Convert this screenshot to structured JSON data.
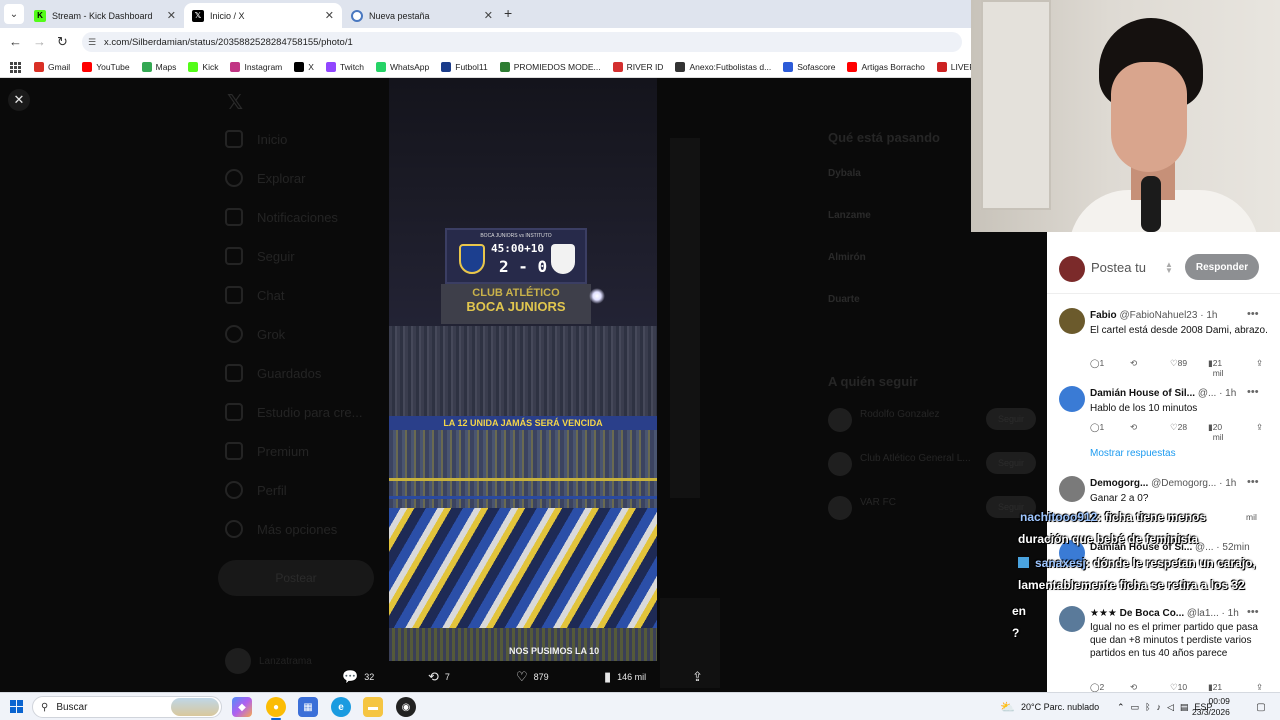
{
  "browser": {
    "tabs": [
      {
        "label": "Stream - Kick Dashboard",
        "icon": "kick-icon",
        "active": false
      },
      {
        "label": "Inicio / X",
        "icon": "x-logo-icon",
        "active": true
      },
      {
        "label": "Nueva pestaña",
        "icon": "chrome-icon",
        "active": false
      }
    ],
    "url": "x.com/Silberdamian/status/2035882528284758155/photo/1",
    "bookmarks": [
      {
        "label": "Gmail",
        "color": "#d93025"
      },
      {
        "label": "YouTube",
        "color": "#ff0000"
      },
      {
        "label": "Maps",
        "color": "#34a853"
      },
      {
        "label": "Kick",
        "color": "#53fc18"
      },
      {
        "label": "Instagram",
        "color": "#c13584"
      },
      {
        "label": "X",
        "color": "#000000"
      },
      {
        "label": "Twitch",
        "color": "#9146ff"
      },
      {
        "label": "WhatsApp",
        "color": "#25d366"
      },
      {
        "label": "Futbol11",
        "color": "#1a3b8a"
      },
      {
        "label": "PROMIEDOS MODE...",
        "color": "#2e7d32"
      },
      {
        "label": "RIVER ID",
        "color": "#d32f2f"
      },
      {
        "label": "Anexo:Futbolistas d...",
        "color": "#333333"
      },
      {
        "label": "Sofascore",
        "color": "#2c5bd8"
      },
      {
        "label": "Artigas Borracho",
        "color": "#ff0000"
      },
      {
        "label": "LIVEFUTBOL",
        "color": "#cc2222"
      }
    ]
  },
  "x_nav": {
    "items": [
      "Inicio",
      "Explorar",
      "Notificaciones",
      "Seguir",
      "Chat",
      "Grok",
      "Guardados",
      "Estudio para cre...",
      "Premium",
      "Perfil",
      "Más opciones"
    ],
    "post_button": "Postear",
    "user_name": "Lanzatrama"
  },
  "x_right": {
    "trending_title": "Qué está pasando",
    "trends": [
      "Dybala",
      "Lanzame",
      "Almirón",
      "Duarte"
    ],
    "follow_title": "A quién seguir",
    "follow": [
      {
        "name": "Rodolfo Gonzalez",
        "button": "Seguir"
      },
      {
        "name": "Club Atlético General L...",
        "button": "Seguir"
      },
      {
        "name": "VAR FC",
        "button": "Seguir"
      }
    ]
  },
  "photo": {
    "board_line": "BOCA JUNIORS vs INSTITUTO",
    "clock": "45:00+10",
    "score": "2 - 0",
    "club_line1": "CLUB ATLÉTICO",
    "club_line2": "BOCA JUNIORS",
    "banner1": "LA 12 UNIDA JAMÁS SERÁ VENCIDA",
    "banner2": "NOS PUSIMOS LA 10"
  },
  "post_actions": {
    "replies": "32",
    "reposts": "7",
    "likes": "879",
    "views": "146 mil"
  },
  "reply_panel": {
    "compose_placeholder": "Postea tu",
    "reply_button": "Responder",
    "show_more": "Mostrar respuestas",
    "replies": [
      {
        "name": "Fabio",
        "handle": "@FabioNahuel23 · 1h",
        "text": "El cartel está desde 2008 Dami, abrazo.",
        "replies": "1",
        "likes": "89",
        "views": "21 mil",
        "avatar_color": "#6b5a2c"
      },
      {
        "name": "Damián House of Sil...",
        "handle": "@... · 1h",
        "text": "Hablo de los 10 minutos",
        "replies": "1",
        "likes": "28",
        "views": "20 mil",
        "avatar_color": "#3a7bd5"
      },
      {
        "name": "Demogorg...",
        "handle": "@Demogorg... · 1h",
        "text": "Ganar 2 a 0?",
        "replies": "",
        "likes": "",
        "views": "mil",
        "avatar_color": "#7a7a7a"
      },
      {
        "name": "Damián House of Si...",
        "handle": "@... · 52min",
        "text": "",
        "replies": "",
        "likes": "",
        "views": "",
        "avatar_color": "#3a7bd5"
      },
      {
        "name": "★★★ De Boca Co...",
        "handle": "@la1... · 1h",
        "text": "Igual no es el primer partido que pasa que dan +8 minutos t perdiste varios partidos en tus 40 años parece",
        "replies": "2",
        "likes": "10",
        "views": "21 mil",
        "avatar_color": "#5a7a9a"
      }
    ]
  },
  "chat": [
    {
      "user": "nachitooo912",
      "text": ": ficha tiene menos"
    },
    {
      "user": "",
      "text": "duración que bebé de feminista"
    },
    {
      "user": "sanaxesj",
      "text": ": dónde le respetan un carajo,"
    },
    {
      "user": "",
      "text": "lamentablemente ficha se retira a los 32"
    },
    {
      "user": "",
      "text": "en"
    },
    {
      "user": "",
      "text": "?"
    }
  ],
  "taskbar": {
    "search_label": "Buscar",
    "weather": "20°C  Parc. nublado",
    "lang": "ESP",
    "time": "00:09",
    "date": "23/3/2026"
  }
}
